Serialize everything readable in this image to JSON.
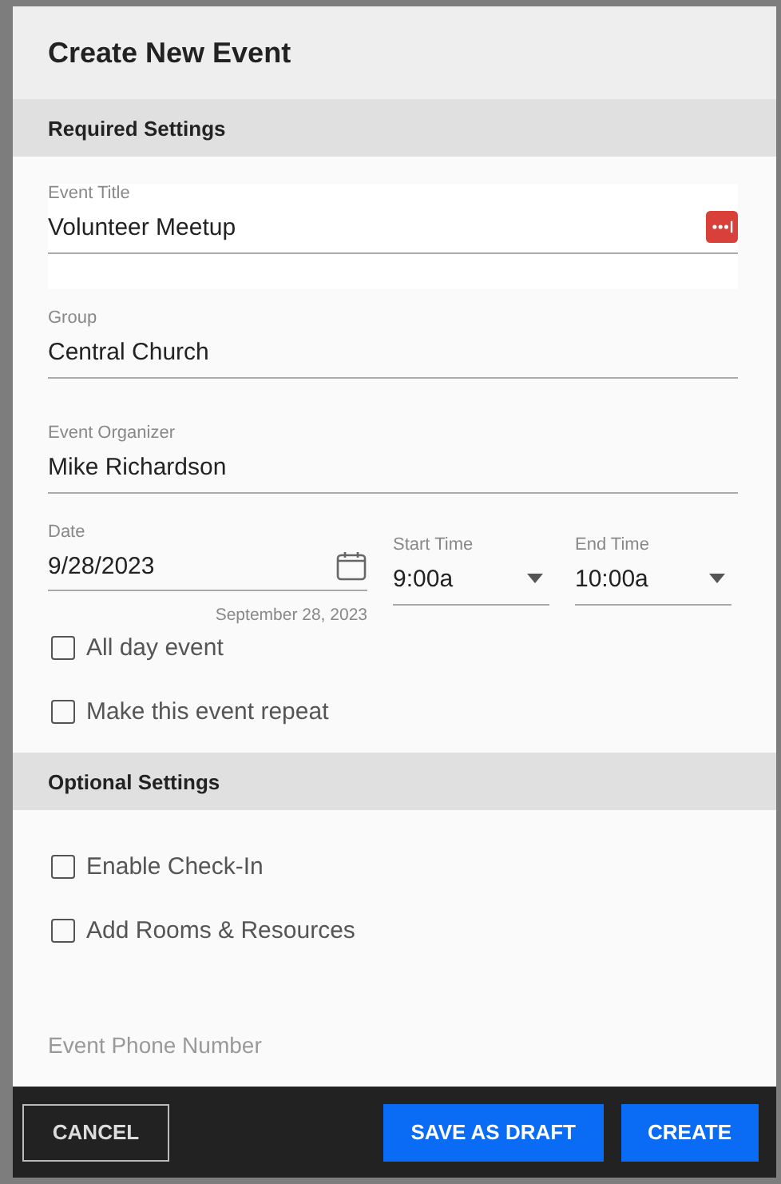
{
  "dialog": {
    "title": "Create New Event"
  },
  "sections": [
    {
      "heading": "Required Settings",
      "items": [
        {
          "kind": "text",
          "label": "Event Title",
          "value": "Volunteer Meetup",
          "highlighted": true
        },
        {
          "kind": "text",
          "label": "Group",
          "value": "Central Church",
          "highlighted": false
        },
        {
          "kind": "text",
          "label": "Event Organizer",
          "value": "Mike Richardson",
          "highlighted": false
        },
        {
          "kind": "datetime",
          "date": {
            "label": "Date",
            "value": "9/28/2023",
            "hint": "September 28, 2023"
          },
          "times": [
            {
              "label": "Start Time",
              "value": "9:00a"
            },
            {
              "label": "End Time",
              "value": "10:00a"
            }
          ]
        },
        {
          "kind": "checkbox",
          "label": "All day event",
          "checked": false
        },
        {
          "kind": "checkbox",
          "label": "Make this event repeat",
          "checked": false
        }
      ]
    },
    {
      "heading": "Optional Settings",
      "items": [
        {
          "kind": "checkbox",
          "label": "Enable Check-In",
          "checked": false
        },
        {
          "kind": "checkbox",
          "label": "Add Rooms & Resources",
          "checked": false
        },
        {
          "kind": "label",
          "label": "Event Phone Number"
        }
      ]
    }
  ],
  "footer": {
    "cancel": "CANCEL",
    "actions": [
      "SAVE AS DRAFT",
      "CREATE"
    ]
  }
}
